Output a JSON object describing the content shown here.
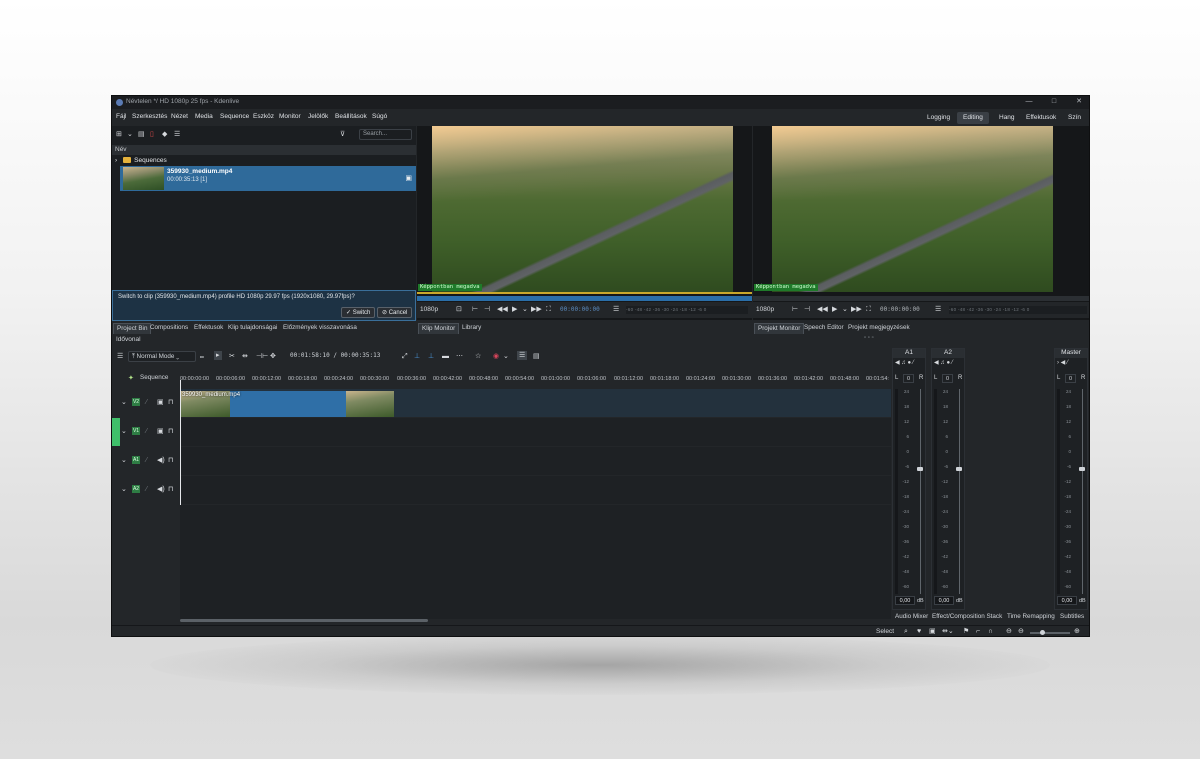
{
  "window": {
    "title": "Névtelen */ HD 1080p 25 fps - Kdenlive",
    "controls": [
      "—",
      "□",
      "✕"
    ]
  },
  "menu": [
    "Fájl",
    "Szerkesztés",
    "Nézet",
    "Media",
    "Sequence",
    "Eszköz",
    "Monitor",
    "Jelölők",
    "Beállítások",
    "Súgó"
  ],
  "workspaces": [
    {
      "label": "Logging",
      "active": false
    },
    {
      "label": "Editing",
      "active": true
    },
    {
      "label": "Hang",
      "active": false
    },
    {
      "label": "Effektusok",
      "active": false
    },
    {
      "label": "Szín",
      "active": false
    }
  ],
  "bin": {
    "search_placeholder": "Search...",
    "column_header": "Név",
    "folder": "Sequences",
    "clip": {
      "name": "359930_medium.mp4",
      "duration": "00:00:35:13 [1]"
    },
    "notice": "Switch to clip (359930_medium.mp4) profile HD 1080p 29.97 fps (1920x1080, 29.97fps)?",
    "switch_label": "Switch",
    "cancel_label": "Cancel",
    "tabs": [
      "Project Bin",
      "Compositions",
      "Effektusok",
      "Klip tulajdonságai",
      "Előzmények visszavonása"
    ]
  },
  "clip_monitor": {
    "osd": "Képpontban megadva",
    "resolution": "1080p",
    "timecode": "00:00:00:00",
    "tabs": [
      "Klip Monitor",
      "Library"
    ]
  },
  "project_monitor": {
    "osd": "Képpontban megadva",
    "resolution": "1080p",
    "timecode": "00:00:00:00",
    "tabs": [
      "Projekt Monitor",
      "Speech Editor",
      "Projekt megjegyzések"
    ]
  },
  "meter_scale": "-60 -48 -42 -36 -30 -24 -18 -12 -6 0",
  "timeline": {
    "title": "Idővonal",
    "mode": "Normal Mode",
    "timecode": "00:01:58:10 / 00:00:35:13",
    "sequence_label": "Sequence",
    "ruler": [
      "00:00:00:00",
      "00:00:06:00",
      "00:00:12:00",
      "00:00:18:00",
      "00:00:24:00",
      "00:00:30:00",
      "00:00:36:00",
      "00:00:42:00",
      "00:00:48:00",
      "00:00:54:00",
      "00:01:00:00",
      "00:01:06:00",
      "00:01:12:00",
      "00:01:18:00",
      "00:01:24:00",
      "00:01:30:00",
      "00:01:36:00",
      "00:01:42:00",
      "00:01:48:00",
      "00:01:54:"
    ],
    "tracks": [
      {
        "label": "V2",
        "type": "video"
      },
      {
        "label": "V1",
        "type": "video"
      },
      {
        "label": "A1",
        "type": "audio"
      },
      {
        "label": "A2",
        "type": "audio"
      }
    ],
    "clip_on_track": "359930_medium.mp4"
  },
  "mixer": {
    "strips": [
      {
        "name": "A1",
        "value": "0,00",
        "unit": "dB"
      },
      {
        "name": "A2",
        "value": "0,00",
        "unit": "dB"
      },
      {
        "name": "Master",
        "value": "0,00",
        "unit": "dB"
      }
    ],
    "scale": [
      "24",
      "18",
      "12",
      "6",
      "0",
      "-6",
      "-12",
      "-18",
      "-24",
      "-30",
      "-36",
      "-42",
      "-48",
      "-60"
    ],
    "tabs": [
      "Audio Mixer",
      "Effect/Composition Stack",
      "Time Remapping",
      "Subtitles"
    ]
  },
  "statusbar": {
    "select_label": "Select"
  }
}
